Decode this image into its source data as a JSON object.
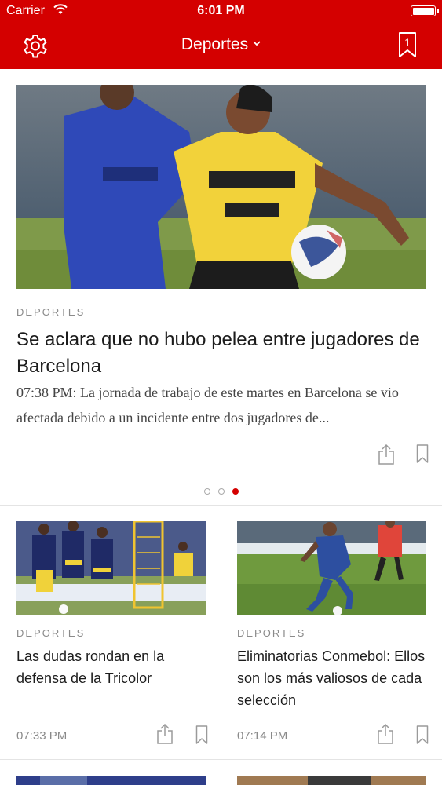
{
  "status_bar": {
    "carrier": "Carrier",
    "time": "6:01 PM"
  },
  "nav": {
    "title": "Deportes",
    "bookmark_count": "1",
    "accent_color": "#d40000"
  },
  "featured": {
    "category": "DEPORTES",
    "headline": "Se aclara que no hubo pelea entre jugadores de Barcelona",
    "summary": "07:38 PM: La jornada de trabajo de este martes en Barcelona se vio afectada debido a un incidente entre dos jugadores de...",
    "image_icon": "soccer-match-photo"
  },
  "carousel": {
    "page_count": 3,
    "active_index": 2
  },
  "cards": [
    {
      "category": "DEPORTES",
      "headline": "Las dudas rondan en la defensa de la Tricolor",
      "time": "07:33 PM",
      "image_icon": "team-training-photo"
    },
    {
      "category": "DEPORTES",
      "headline": "Eliminatorias Conmebol: Ellos son los más valiosos de cada selección",
      "time": "07:14 PM",
      "image_icon": "player-dribbling-photo"
    }
  ]
}
